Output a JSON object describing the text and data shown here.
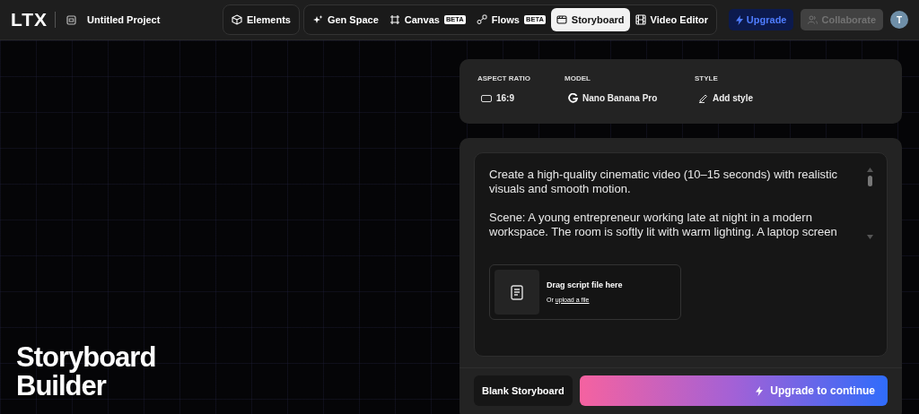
{
  "header": {
    "logo": "LTX",
    "project_title": "Untitled Project",
    "tabs": [
      {
        "label": "Elements",
        "selected": false
      },
      {
        "label": "Gen Space",
        "selected": false
      },
      {
        "label": "Canvas",
        "badge": "BETA",
        "selected": false
      },
      {
        "label": "Flows",
        "badge": "BETA",
        "selected": false
      },
      {
        "label": "Storyboard",
        "selected": true
      },
      {
        "label": "Video Editor",
        "selected": false
      }
    ],
    "upgrade_button": "Upgrade",
    "collaborate_button": {
      "label": "Collaborate",
      "disabled": true
    },
    "avatar": "T"
  },
  "hero_title": "Storyboard Builder",
  "settings": [
    {
      "label": "ASPECT RATIO",
      "value": "16:9"
    },
    {
      "label": "MODEL",
      "value": "Nano Banana Pro"
    },
    {
      "label": "STYLE",
      "value": "Add style"
    }
  ],
  "prompt": {
    "value": "Create a high-quality cinematic video (10–15 seconds) with realistic visuals and smooth motion.\n\nScene: A young entrepreneur working late at night in a modern workspace. The room is softly lit with warm lighting. A laptop screen"
  },
  "upload": {
    "title": "Drag script file here",
    "prefix": "Or",
    "link": "upload a file"
  },
  "footer": {
    "secondary_button": "Blank Storyboard",
    "primary_button": "Upgrade to continue"
  }
}
